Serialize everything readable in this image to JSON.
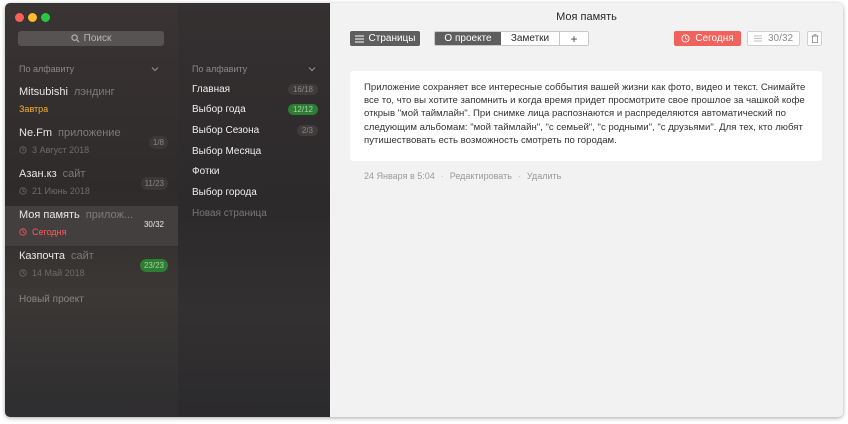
{
  "search": {
    "label": "Поиск"
  },
  "projects_sort": {
    "label": "По алфавиту"
  },
  "projects": [
    {
      "name": "Mitsubishi",
      "type": "лэндинг",
      "date": "Завтра",
      "date_style": "yellow",
      "show_clock": false,
      "badge": "",
      "badge_style": ""
    },
    {
      "name": "Ne.Fm",
      "type": "приложение",
      "date": "3 Август 2018",
      "date_style": "gray",
      "show_clock": true,
      "badge": "1/8",
      "badge_style": "gray"
    },
    {
      "name": "Азан.кз",
      "type": "сайт",
      "date": "21 Июнь 2018",
      "date_style": "gray",
      "show_clock": true,
      "badge": "11/23",
      "badge_style": "gray"
    },
    {
      "name": "Моя память",
      "type": "прилож...",
      "date": "Сегодня",
      "date_style": "red",
      "show_clock": true,
      "badge": "30/32",
      "badge_style": "plain",
      "active": true
    },
    {
      "name": "Казпочта",
      "type": "сайт",
      "date": "14 Май 2018",
      "date_style": "gray",
      "show_clock": true,
      "badge": "23/23",
      "badge_style": "green"
    }
  ],
  "new_project": "Новый проект",
  "pages_sort": {
    "label": "По алфавиту"
  },
  "pages": [
    {
      "label": "Главная",
      "badge": "16/18",
      "badge_style": "gray"
    },
    {
      "label": "Выбор года",
      "badge": "12/12",
      "badge_style": "green"
    },
    {
      "label": "Выбор Сезона",
      "badge": "2/3",
      "badge_style": "gray"
    },
    {
      "label": "Выбор Месяца",
      "badge": "",
      "badge_style": ""
    },
    {
      "label": "Фотки",
      "badge": "",
      "badge_style": ""
    },
    {
      "label": "Выбор города",
      "badge": "",
      "badge_style": ""
    }
  ],
  "new_page": "Новая страница",
  "main": {
    "title": "Моя память",
    "pages_button": "Страницы",
    "tabs": [
      {
        "label": "О проекте",
        "active": true
      },
      {
        "label": "Заметки",
        "active": false
      }
    ],
    "add_tab": "+",
    "today_button": "Сегодня",
    "count_button": "30/32",
    "description": "Приложение сохраняет все интересные соббытия вашей жизни как фото, видео и текст. Снимайте все то, что вы хотите запомнить и когда время придет просмотрите свое прошлое за чашкой кофе открыв \"мой таймлайн\". При снимке лица распознаются и распределяются автоматический по следующим альбомам: \"мой таймлайн\", \"с семьей\", \"с родными\", \"с друзьями\". Для тех, кто любят путишествовать есть возможность смотреть по городам.",
    "meta_date": "24 Января в 5:04",
    "edit": "Редактировать",
    "delete": "Удалить"
  },
  "colors": {
    "accent_red": "#f0625b",
    "badge_green": "#2f7d35",
    "tomorrow_yellow": "#f5b325"
  }
}
